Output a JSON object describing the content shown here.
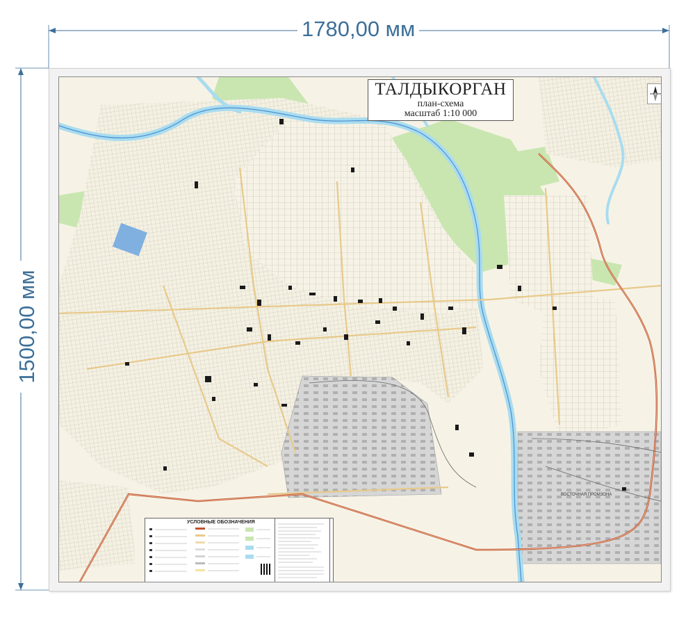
{
  "dimensions": {
    "width_label": "1780,00 мм",
    "height_label": "1500,00 мм"
  },
  "map": {
    "title": "ТАЛДЫКОРГАН",
    "subtitle": "план-схема",
    "scale": "масштаб 1:10 000",
    "legend_title": "УСЛОВНЫЕ ОБОЗНАЧЕНИЯ",
    "district_label": "ВОСТОЧНАЯ ПРОМЗОНА",
    "colors": {
      "land": "#f6f3e6",
      "river": "#a9dcef",
      "green": "#c9e6b0",
      "road_ring": "#c0522e",
      "industrial": "#d3d3d3",
      "block": "#1a1a1a"
    }
  }
}
